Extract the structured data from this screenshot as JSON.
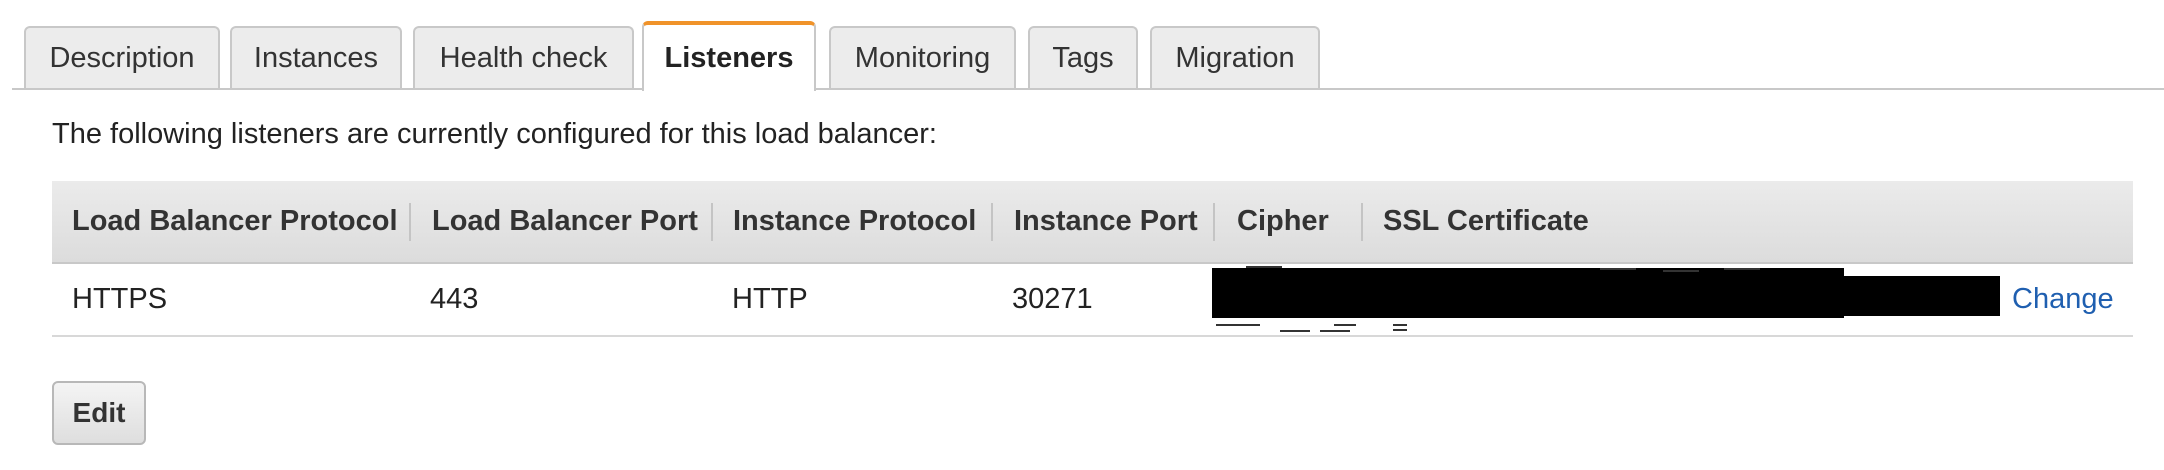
{
  "tabs": [
    {
      "label": "Description",
      "active": false
    },
    {
      "label": "Instances",
      "active": false
    },
    {
      "label": "Health check",
      "active": false
    },
    {
      "label": "Listeners",
      "active": true
    },
    {
      "label": "Monitoring",
      "active": false
    },
    {
      "label": "Tags",
      "active": false
    },
    {
      "label": "Migration",
      "active": false
    }
  ],
  "listeners": {
    "intro": "The following listeners are currently configured for this load balancer:",
    "columns": [
      "Load Balancer Protocol",
      "Load Balancer Port",
      "Instance Protocol",
      "Instance Port",
      "Cipher",
      "SSL Certificate"
    ],
    "rows": [
      {
        "lb_protocol": "HTTPS",
        "lb_port": "443",
        "instance_protocol": "HTTP",
        "instance_port": "30271",
        "change_label": "Change"
      }
    ],
    "edit_label": "Edit"
  },
  "colors": {
    "active_tab_accent": "#f0932a",
    "link": "#1f5fb0"
  }
}
